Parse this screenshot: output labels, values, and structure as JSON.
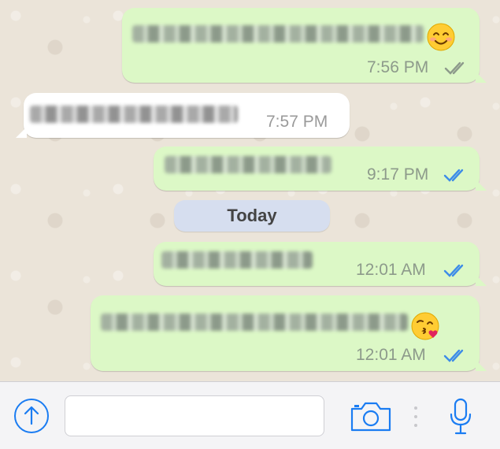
{
  "messages": [
    {
      "id": 1,
      "direction": "outgoing",
      "text_redacted": true,
      "emoji": "smiling-face-icon",
      "time": "7:56 PM",
      "status": "read-gray"
    },
    {
      "id": 2,
      "direction": "incoming",
      "text_redacted": true,
      "time": "7:57 PM"
    },
    {
      "id": 3,
      "direction": "outgoing",
      "text_redacted": true,
      "time": "9:17 PM",
      "status": "read-blue"
    },
    {
      "id": 4,
      "direction": "outgoing",
      "text_redacted": true,
      "time": "12:01 AM",
      "status": "read-blue"
    },
    {
      "id": 5,
      "direction": "outgoing",
      "text_redacted": true,
      "emoji": "kissing-face-icon",
      "time": "12:01 AM",
      "status": "read-blue"
    }
  ],
  "date_separator": "Today",
  "composer": {
    "input_value": "",
    "icons": [
      "upload-arrow-icon",
      "camera-icon",
      "microphone-icon"
    ]
  },
  "colors": {
    "outgoing_bubble": "#dcf8c6",
    "incoming_bubble": "#ffffff",
    "read_tick_blue": "#3d8ce8",
    "ios_blue": "#1a7cf2",
    "date_pill": "#d6deef"
  }
}
